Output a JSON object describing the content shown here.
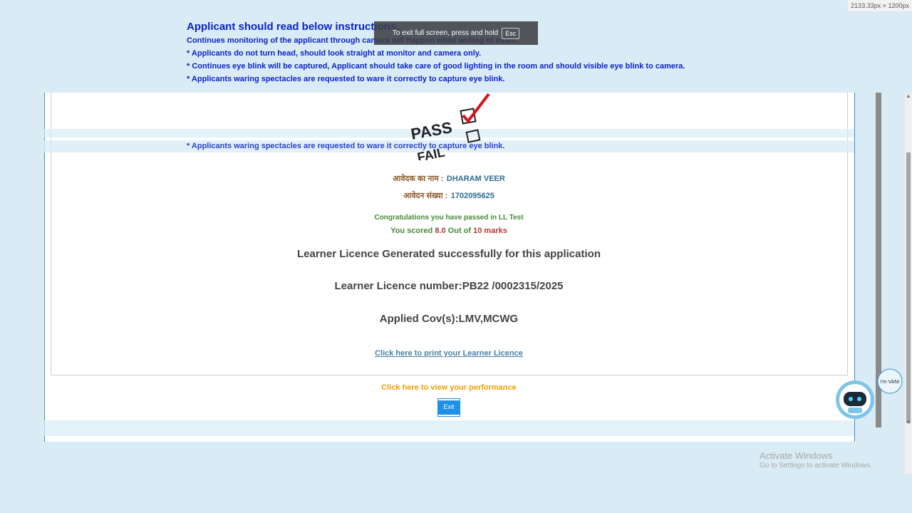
{
  "screen_dims": "2133.33px × 1200px",
  "instructions": {
    "title": "Applicant should read below instructions.",
    "lines": [
      "Continues monitoring of the applicant through camera will happen while writing of exam.",
      "* Applicants do not turn head, should look straight at monitor and camera only.",
      "* Continues eye blink will be captured, Applicant should take care of good lighting in the room and should visible eye blink to camera.",
      "* Applicants waring spectacles are requested to ware it correctly to capture eye blink."
    ]
  },
  "toast": {
    "text": "To exit full screen, press and hold",
    "key": "Esc"
  },
  "result_graphic": {
    "pass": "PASS",
    "fail": "FAIL"
  },
  "applicant": {
    "name_label": "आवेदक का नाम :",
    "name_value": "DHARAM VEER",
    "app_no_label": "आवेदन संख्या :",
    "app_no_value": "1702095625"
  },
  "result": {
    "congrats": "Congratulations you have passed in LL Test",
    "score_prefix": "You scored",
    "score": "8.0",
    "out_of": "Out of",
    "total": "10 marks"
  },
  "licence": {
    "generated": "Learner Licence Generated successfully for this application",
    "number_text": "Learner Licence number:PB22 /0002315/2025",
    "covs_text": "Applied Cov(s):LMV,MCWG",
    "print_link": "Click here to print your Learner Licence",
    "performance_link": "Click here to view your performance",
    "exit_button": "Exit"
  },
  "chat_bot": {
    "badge": "I'm VANI"
  },
  "watermark": {
    "title": "Activate Windows",
    "subtitle": "Go to Settings to activate Windows."
  },
  "colors": {
    "page_bg": "#d9ecf6",
    "instruction_blue": "#0c21c9",
    "panel_border": "#3b8fbf",
    "performance_orange": "#f0a000",
    "score_red": "#b03a2e",
    "score_green": "#4a8a3a"
  }
}
